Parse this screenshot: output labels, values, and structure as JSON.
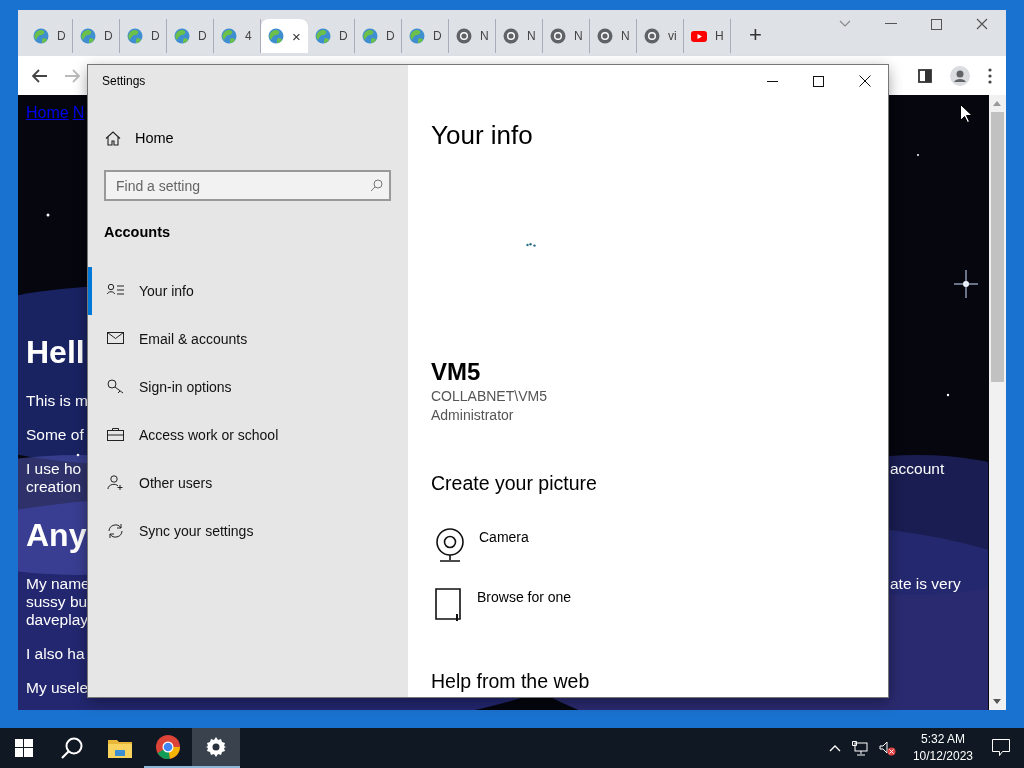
{
  "browser": {
    "tabs": [
      {
        "kind": "globe",
        "title": "D",
        "selected": false
      },
      {
        "kind": "globe",
        "title": "D",
        "selected": false
      },
      {
        "kind": "globe",
        "title": "D",
        "selected": false
      },
      {
        "kind": "globe",
        "title": "D",
        "selected": false
      },
      {
        "kind": "globe",
        "title": "4",
        "selected": false
      },
      {
        "kind": "globe",
        "close": "×",
        "selected": true
      },
      {
        "kind": "globe",
        "title": "D",
        "selected": false
      },
      {
        "kind": "globe",
        "title": "D",
        "selected": false
      },
      {
        "kind": "globe",
        "title": "D",
        "selected": false
      },
      {
        "kind": "chrome",
        "title": "N",
        "selected": false
      },
      {
        "kind": "chrome",
        "title": "N",
        "selected": false
      },
      {
        "kind": "chrome",
        "title": "N",
        "selected": false
      },
      {
        "kind": "chrome",
        "title": "N",
        "selected": false
      },
      {
        "kind": "chrome",
        "title": "vi",
        "selected": false
      },
      {
        "kind": "youtube",
        "title": "H",
        "selected": false
      }
    ],
    "new_tab": "+",
    "page": {
      "links": [
        "Home",
        "N"
      ],
      "rows": [
        {
          "kind": "heading",
          "left": [
            "Hell"
          ]
        },
        {
          "kind": "para",
          "left": [
            "This is m"
          ]
        },
        {
          "kind": "para",
          "left": [
            "Some of"
          ]
        },
        {
          "kind": "para",
          "left": [
            "I use ho",
            "creation"
          ],
          "right": [
            "account"
          ]
        },
        {
          "kind": "heading",
          "left": [
            "Any"
          ]
        },
        {
          "kind": "para",
          "left": [
            "My name",
            "sussy bu",
            "daveplay"
          ],
          "right": [
            "ate is very"
          ]
        },
        {
          "kind": "para",
          "left": [
            "I also ha"
          ]
        },
        {
          "kind": "para",
          "left": [
            "My usele"
          ]
        }
      ]
    }
  },
  "settings": {
    "window_title": "Settings",
    "home": "Home",
    "search": {
      "placeholder": "Find a setting"
    },
    "section": "Accounts",
    "nav": [
      {
        "kind": "person-list",
        "label": "Your info",
        "selected": true
      },
      {
        "kind": "mail",
        "label": "Email & accounts",
        "selected": false
      },
      {
        "kind": "key",
        "label": "Sign-in options",
        "selected": false
      },
      {
        "kind": "briefcase",
        "label": "Access work or school",
        "selected": false
      },
      {
        "kind": "person-add",
        "label": "Other users",
        "selected": false
      },
      {
        "kind": "sync",
        "label": "Sync your settings",
        "selected": false
      }
    ],
    "heading": "Your info",
    "user_name": "VM5",
    "account": "COLLABNET\\VM5",
    "role": "Administrator",
    "picture_heading": "Create your picture",
    "picture_options": [
      {
        "kind": "camera",
        "label": "Camera"
      },
      {
        "kind": "file",
        "label": "Browse for one"
      }
    ],
    "help_heading": "Help from the web"
  },
  "taskbar": {
    "apps": [
      {
        "kind": "start",
        "running": false,
        "active": false
      },
      {
        "kind": "search",
        "running": false,
        "active": false
      },
      {
        "kind": "explorer",
        "running": false,
        "active": false
      },
      {
        "kind": "chrome",
        "running": true,
        "active": false
      },
      {
        "kind": "settings",
        "running": true,
        "active": true
      }
    ],
    "time": "5:32 AM",
    "date": "10/12/2023"
  }
}
